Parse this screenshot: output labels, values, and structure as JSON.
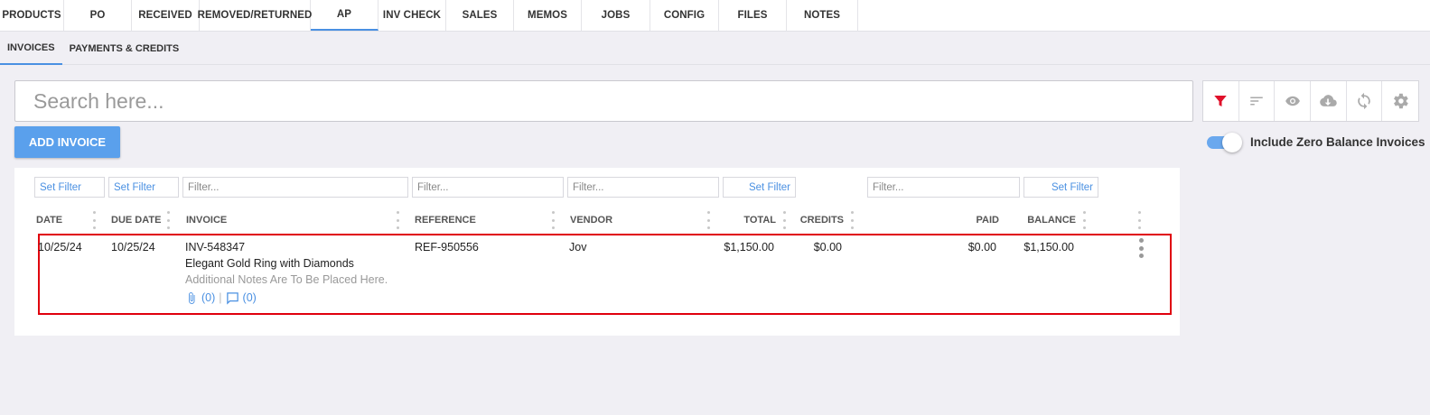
{
  "top_tabs": [
    "PRODUCTS",
    "PO",
    "RECEIVED",
    "REMOVED/RETURNED",
    "AP",
    "INV CHECK",
    "SALES",
    "MEMOS",
    "JOBS",
    "CONFIG",
    "FILES",
    "NOTES"
  ],
  "active_top_tab": "AP",
  "sub_tabs": [
    "INVOICES",
    "PAYMENTS & CREDITS"
  ],
  "active_sub_tab": "INVOICES",
  "search": {
    "placeholder": "Search here..."
  },
  "toolbar": {
    "icons": [
      "filter-icon",
      "sort-icon",
      "eye-icon",
      "cloud-download-icon",
      "refresh-icon",
      "gear-icon"
    ],
    "filter_color": "#e0102a",
    "icon_color": "#aaaaaa"
  },
  "add_button_label": "ADD INVOICE",
  "toggle": {
    "label": "Include Zero Balance Invoices",
    "on": true
  },
  "filters": {
    "set_filter": "Set Filter",
    "placeholder": "Filter..."
  },
  "columns": {
    "date": "DATE",
    "due_date": "DUE DATE",
    "invoice": "INVOICE",
    "reference": "REFERENCE",
    "vendor": "VENDOR",
    "total": "TOTAL",
    "credits": "CREDITS",
    "paid": "PAID",
    "balance": "BALANCE"
  },
  "rows": [
    {
      "date": "10/25/24",
      "due_date": "10/25/24",
      "invoice": "INV-548347",
      "description": "Elegant Gold Ring with Diamonds",
      "notes": "Additional Notes Are To Be Placed Here.",
      "attachments": "(0)",
      "comments": "(0)",
      "reference": "REF-950556",
      "vendor": "Jov",
      "total": "$1,150.00",
      "credits": "$0.00",
      "paid": "$0.00",
      "balance": "$1,150.00"
    }
  ],
  "colors": {
    "accent": "#4a90e2",
    "highlight": "#e0000d",
    "button": "#5aa0ec"
  }
}
